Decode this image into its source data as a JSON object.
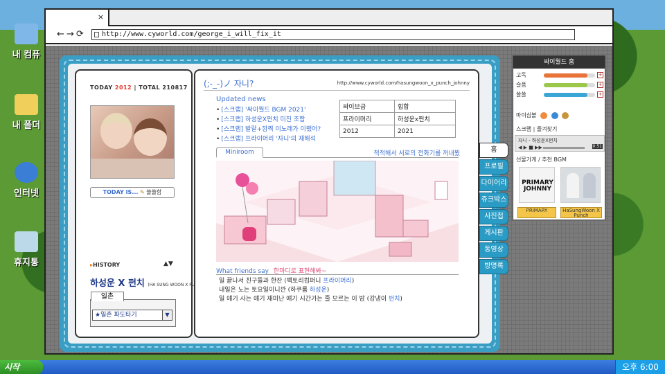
{
  "desktop": {
    "icons": [
      {
        "label": "내 컴퓨"
      },
      {
        "label": "내 폴더"
      },
      {
        "label": "인터넷"
      },
      {
        "label": "휴지통"
      }
    ]
  },
  "taskbar": {
    "start_label": "시작",
    "clock": "오후 6:00"
  },
  "browser": {
    "tab_close": "×",
    "back": "←",
    "forward": "→",
    "refresh": "⟳",
    "url": "http://www.cyworld.com/george_i_will_fix_it"
  },
  "minihompy": {
    "today_label": "TODAY",
    "today_count": "2012",
    "total_label": "TOTAL",
    "total_count": "210817",
    "today_is_label": "TODAY IS...",
    "today_is_mood": "쓸쓸함",
    "history_label": "HISTORY",
    "history_arrows": "▲▼",
    "owner_name": "하성운 X 펀치",
    "owner_sub": "(HA SUNG WOON X PUNCH)",
    "ilchon_label": "일촌",
    "ilchon_selected": "★일촌 파도타기",
    "mood_text": "(;-_-)ノ 자니?",
    "home_url": "http://www.cyworld.com/hasungwoon_x_punch_johnny",
    "updated_title": "Updated news",
    "updated_news": [
      "[스크랩] '싸이월드 BGM 2021'",
      "[스크랩] 하성운X펀치 미친 조합",
      "[스크랩] 발랄+깜찍 이노래가 이랬어?",
      "[스크랩] 프라이머리 '자니'의 재해석"
    ],
    "stats": [
      [
        "싸이브금",
        "힙합"
      ],
      [
        "프라이머리",
        "하성운x펀치"
      ],
      [
        "2012",
        "2021"
      ]
    ],
    "miniroom_label": "Miniroom",
    "miniroom_caption": "적적해서 서로의 전화기를 꺼내뵜",
    "friends_title": "What friends say",
    "friends_hand": "한마디로 표현해봐~",
    "friends_say": [
      {
        "pre": "일 끝나서 친구들과 한잔 (팩토리컴퍼니 ",
        "hl": "프라이머리",
        "post": ")"
      },
      {
        "pre": "내일은 노는 토요일이니깐 (하쿠룸 ",
        "hl": "하성운",
        "post": ")"
      },
      {
        "pre": "일 얘기 사는 얘기 재미난 얘기 시간가는 줄 모르는 이 밤 (강냉이 ",
        "hl": "펀치",
        "post": ")"
      }
    ],
    "side_tabs": [
      "홈",
      "프로필",
      "다이어리",
      "쥬크박스",
      "사진첩",
      "게시판",
      "동영상",
      "방명록"
    ]
  },
  "widget": {
    "title": "싸이월드 홈",
    "stats": [
      {
        "label": "고독",
        "level": 0.85,
        "color": "#e8743a"
      },
      {
        "label": "슬픔",
        "level": 0.85,
        "color": "#9bc74a"
      },
      {
        "label": "쓸쓸",
        "level": 0.85,
        "color": "#3aa6d6"
      }
    ],
    "plus": "+",
    "mysim_label": "마이심볼",
    "links": "스크랩  |  즐겨찾기",
    "player_song": "자니 - 하성운X펀치",
    "player_controls": "◀ ▶ ■ ▶▶",
    "player_time": "0:51",
    "gift_title": "선물가게 / 추천 BGM",
    "album1_text": "PRIMARY\nJOHNNY",
    "album1_button": "PRIMARY",
    "album2_button": "HaSungWoon X Punch"
  }
}
